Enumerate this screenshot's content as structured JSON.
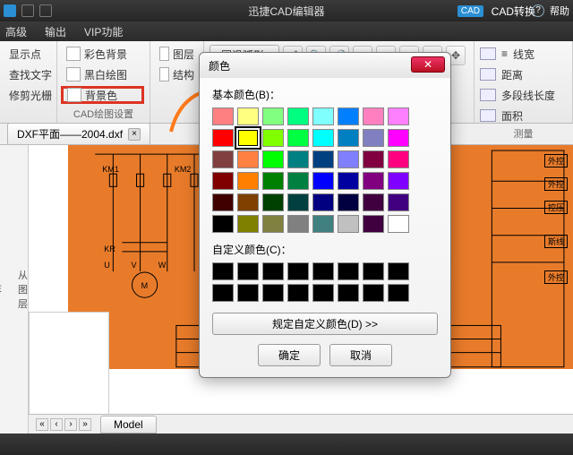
{
  "titlebar": {
    "title": "迅捷CAD编辑器",
    "cad_badge": "CAD",
    "convert": "CAD转换",
    "help": "帮助",
    "helpq": "?"
  },
  "menu": {
    "adv": "高级",
    "out": "输出",
    "vip": "VIP功能"
  },
  "ribbon": {
    "g1": {
      "showpt": "显示点",
      "findtxt": "查找文字",
      "clip": "修剪光栅"
    },
    "g2": {
      "colorbg": "彩色背景",
      "bw": "黑白绘图",
      "bgcolor": "背景色",
      "label": "CAD绘图设置"
    },
    "g3": {
      "layer": "图层",
      "struct": "结构"
    },
    "arc": "圆滑弧形",
    "meas": {
      "linew": "线宽",
      "dist": "距离",
      "poly": "多段线长度",
      "area": "面积",
      "label": "测量"
    }
  },
  "doc": {
    "tab": "DXF平面——2004.dxf"
  },
  "leftdock": {
    "a": "从图层",
    "b": "DE",
    "c": "层"
  },
  "schem": {
    "km1": "KM1",
    "km2": "KM2",
    "kr": "KR",
    "u": "U",
    "v": "V",
    "w": "W",
    "m": "M"
  },
  "right_tags": [
    "外控",
    "外控",
    "控压",
    "斯线",
    "外控"
  ],
  "dialog": {
    "title": "颜色",
    "basic_label": "基本颜色(B)：",
    "custom_label": "自定义颜色(C)：",
    "define": "规定自定义颜色(D) >>",
    "ok": "确定",
    "cancel": "取消",
    "basic_colors": [
      "#ff8080",
      "#ffff80",
      "#80ff80",
      "#00ff80",
      "#80ffff",
      "#0080ff",
      "#ff80c0",
      "#ff80ff",
      "#ff0000",
      "#ffff00",
      "#80ff00",
      "#00ff40",
      "#00ffff",
      "#0080c0",
      "#8080c0",
      "#ff00ff",
      "#804040",
      "#ff8040",
      "#00ff00",
      "#008080",
      "#004080",
      "#8080ff",
      "#800040",
      "#ff0080",
      "#800000",
      "#ff8000",
      "#008000",
      "#008040",
      "#0000ff",
      "#0000a0",
      "#800080",
      "#8000ff",
      "#400000",
      "#804000",
      "#004000",
      "#004040",
      "#000080",
      "#000040",
      "#400040",
      "#400080",
      "#000000",
      "#808000",
      "#808040",
      "#808080",
      "#408080",
      "#c0c0c0",
      "#400040",
      "#ffffff"
    ],
    "selected_index": 9,
    "custom_colors": [
      "#000000",
      "#000000",
      "#000000",
      "#000000",
      "#000000",
      "#000000",
      "#000000",
      "#000000",
      "#000000",
      "#000000",
      "#000000",
      "#000000",
      "#000000",
      "#000000",
      "#000000",
      "#000000"
    ]
  },
  "bottom": {
    "model": "Model"
  }
}
